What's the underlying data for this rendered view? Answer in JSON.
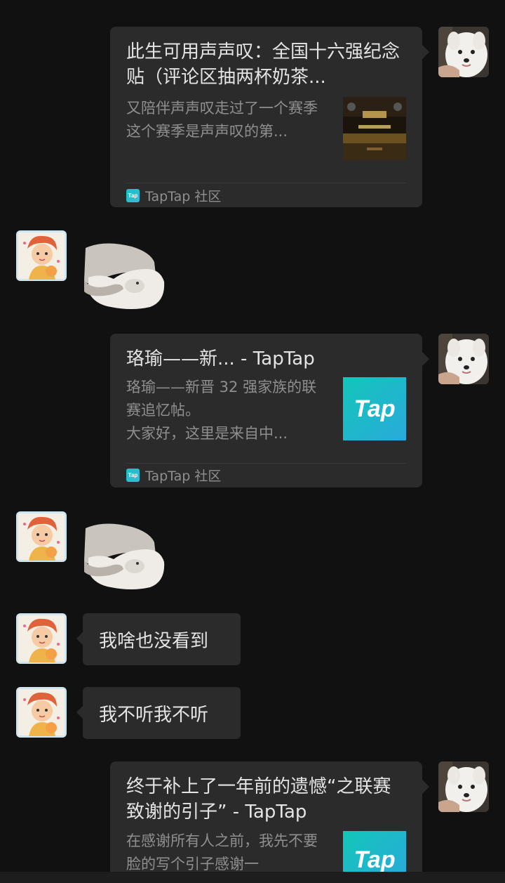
{
  "colors": {
    "background": "#111111",
    "bubble": "#2b2b2b",
    "title_text": "#e4e4e4",
    "muted_text": "#8f8f8f",
    "tap_teal": "#13c4c4"
  },
  "messages": [
    {
      "sender": "me",
      "type": "link-card",
      "title": "此生可用声声叹：全国十六强纪念贴（评论区抽两杯奶茶...",
      "desc": "又陪伴声声叹走过了一个赛季\n这个赛季是声声叹的第...",
      "thumbnail": "event-poster",
      "source_icon": "Tap",
      "source": "TapTap 社区"
    },
    {
      "sender": "other",
      "type": "sticker",
      "sticker": "hand-squeezing-dog"
    },
    {
      "sender": "me",
      "type": "link-card",
      "title": "珞瑜——新... - TapTap",
      "desc": "珞瑜——新晋 32 强家族的联赛追忆帖。\n 大家好，这里是来自中...",
      "thumbnail": "tap-logo",
      "thumbnail_text": "Tap",
      "source_icon": "Tap",
      "source": "TapTap 社区"
    },
    {
      "sender": "other",
      "type": "sticker",
      "sticker": "hand-squeezing-dog"
    },
    {
      "sender": "other",
      "type": "text",
      "text": "我啥也没看到"
    },
    {
      "sender": "other",
      "type": "text",
      "text": "我不听我不听"
    },
    {
      "sender": "me",
      "type": "link-card",
      "title": "终于补上了一年前的遗憾“之联赛致谢的引子” - TapTap",
      "desc": "在感谢所有人之前，我先不要脸的写个引子感谢一",
      "thumbnail": "tap-logo",
      "thumbnail_text": "Tap"
    }
  ]
}
